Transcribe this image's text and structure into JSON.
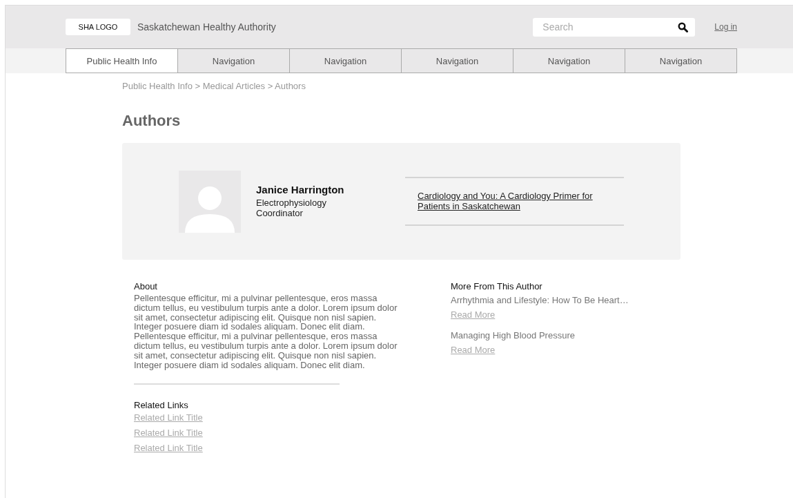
{
  "header": {
    "logo": "SHA LOGO",
    "site_name": "Saskatchewan Healthy Authority",
    "search": {
      "placeholder": "Search"
    },
    "login": "Log in"
  },
  "nav": [
    {
      "label": "Public Health Info",
      "selected": true
    },
    {
      "label": "Navigation",
      "selected": false
    },
    {
      "label": "Navigation",
      "selected": false
    },
    {
      "label": "Navigation",
      "selected": false
    },
    {
      "label": "Navigation",
      "selected": false
    },
    {
      "label": "Navigation",
      "selected": false
    }
  ],
  "breadcrumb": "Public Health Info > Medical Articles > Authors",
  "title": "Authors",
  "author": {
    "name": "Janice Harrington",
    "role": "Electrophysiology Coordinator",
    "featured_article": "Cardiology and You: A Cardiology Primer for Patients in Saskatchewan"
  },
  "about": {
    "heading": "About",
    "text": "Pellentesque efficitur, mi a pulvinar pellentesque, eros massa dictum tellus, eu vestibulum turpis ante a dolor. Lorem ipsum dolor sit amet, consectetur adipiscing elit. Quisque non nisl sapien. Integer posuere diam id sodales aliquam. Donec elit diam. Pellentesque efficitur, mi a pulvinar pellentesque, eros massa dictum tellus, eu vestibulum turpis ante a dolor. Lorem ipsum dolor sit amet, consectetur adipiscing elit. Quisque non nisl sapien. Integer posuere diam id sodales aliquam. Donec elit diam."
  },
  "related_links": {
    "heading": "Related Links",
    "links": [
      "Related Link Title",
      "Related Link Title",
      "Related Link Title"
    ]
  },
  "more_from_author": {
    "heading": "More From This Author",
    "articles": [
      {
        "title": "Arrhythmia and Lifestyle: How To Be Heart…",
        "link": "Read More"
      },
      {
        "title": "Managing High Blood Pressure",
        "link": "Read More"
      }
    ]
  }
}
